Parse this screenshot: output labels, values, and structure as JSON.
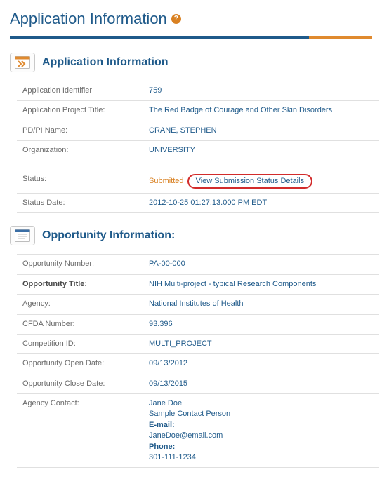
{
  "page": {
    "title": "Application Information"
  },
  "app_info": {
    "section_title": "Application Information",
    "rows": {
      "identifier_label": "Application Identifier",
      "identifier_value": "759",
      "project_title_label": "Application Project Title:",
      "project_title_value": "The Red Badge of Courage and Other Skin Disorders",
      "pdpi_label": "PD/PI Name:",
      "pdpi_value": "CRANE, STEPHEN",
      "org_label": "Organization:",
      "org_value": "UNIVERSITY",
      "status_label": "Status:",
      "status_value": "Submitted",
      "status_link": "View Submission Status Details",
      "status_date_label": "Status Date:",
      "status_date_value": "2012-10-25 01:27:13.000 PM EDT"
    }
  },
  "opp_info": {
    "section_title": "Opportunity Information:",
    "rows": {
      "num_label": "Opportunity Number:",
      "num_value": "PA-00-000",
      "title_label": "Opportunity Title:",
      "title_value": "NIH Multi-project - typical Research Components",
      "agency_label": "Agency:",
      "agency_value": "National Institutes of Health",
      "cfda_label": "CFDA Number:",
      "cfda_value": "93.396",
      "comp_label": "Competition ID:",
      "comp_value": "MULTI_PROJECT",
      "open_label": "Opportunity Open Date:",
      "open_value": "09/13/2012",
      "close_label": "Opportunity Close Date:",
      "close_value": "09/13/2015",
      "contact_label": "Agency Contact:",
      "contact_name": "Jane Doe",
      "contact_role": "Sample Contact Person",
      "contact_email_label": "E-mail:",
      "contact_email_value": "JaneDoe@email.com",
      "contact_phone_label": "Phone:",
      "contact_phone_value": "301-111-1234"
    }
  }
}
